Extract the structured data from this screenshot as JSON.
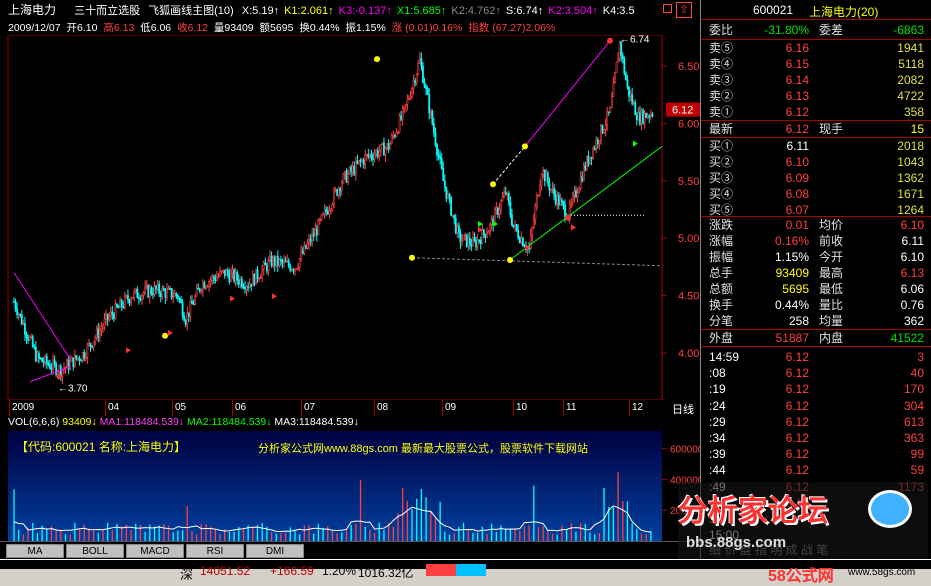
{
  "header": {
    "stock_name": "上海电力",
    "formula_name": "三十而立选股",
    "indicator_name": "飞狐画线主图",
    "indicator_param": "(10)",
    "indicators": [
      {
        "label": "X:5.19",
        "color": "#ffffff"
      },
      {
        "label": "K1:2.061",
        "color": "#ffff00"
      },
      {
        "label": "K3:-0.137",
        "color": "#ff00ff"
      },
      {
        "label": "X1:5.685",
        "color": "#00ff00"
      },
      {
        "label": "K2:4.762",
        "color": "#888888"
      },
      {
        "label": "S:6.74",
        "color": "#ffffff"
      },
      {
        "label": "K2:3.504",
        "color": "#ff00ff"
      },
      {
        "label": "K4:3.5",
        "color": "#ffffff"
      }
    ]
  },
  "infobar": {
    "date": "2009/12/07",
    "open": "开6.10",
    "high": "高6.13",
    "low": "低6.06",
    "close": "收6.12",
    "volume": "量93409",
    "amount": "额5695",
    "turnover": "换0.44%",
    "amplitude": "振1.15%",
    "change": "涨 (0.01)0.16%",
    "index": "指数 (67.27)2.06%"
  },
  "main_chart": {
    "price_axis": [
      "6.50",
      "6.00",
      "5.50",
      "5.00",
      "4.50",
      "4.00"
    ],
    "current_price_label": "6.12",
    "high_annotation": "6.74",
    "low_annotation": "3.70",
    "months": [
      "2009",
      "04",
      "05",
      "06",
      "07",
      "08",
      "09",
      "10",
      "11",
      "12"
    ],
    "period_label": "日线"
  },
  "volume": {
    "title": "VOL(6,6,6)",
    "value": "93409",
    "ma1": "MA1:118484.539",
    "ma2": "MA2:118484.539",
    "ma3": "MA3:118484.539",
    "code_label": "【代码:600021 名称:上海电力】",
    "banner": "分析家公式网www.88gs.com 最新最大股票公式，股票软件下载网站",
    "axis": [
      "600000",
      "400000",
      "200000"
    ]
  },
  "tabs": [
    "MA",
    "BOLL",
    "MACD",
    "RSI",
    "DMI"
  ],
  "right_panel": {
    "code": "600021",
    "name": "上海电力(20)",
    "weibi_label": "委比",
    "weibi_value": "-31.80%",
    "weicha_label": "委差",
    "weicha_value": "-6863",
    "sells": [
      {
        "label": "卖⑤",
        "price": "6.16",
        "vol": "1941"
      },
      {
        "label": "卖④",
        "price": "6.15",
        "vol": "5118"
      },
      {
        "label": "卖③",
        "price": "6.14",
        "vol": "2082"
      },
      {
        "label": "卖②",
        "price": "6.13",
        "vol": "4722"
      },
      {
        "label": "卖①",
        "price": "6.12",
        "vol": "358"
      }
    ],
    "latest_label": "最新",
    "latest_value": "6.12",
    "hand_label": "现手",
    "hand_value": "15",
    "buys": [
      {
        "label": "买①",
        "price": "6.11",
        "vol": "2018"
      },
      {
        "label": "买②",
        "price": "6.10",
        "vol": "1043"
      },
      {
        "label": "买③",
        "price": "6.09",
        "vol": "1362"
      },
      {
        "label": "买④",
        "price": "6.08",
        "vol": "1671"
      },
      {
        "label": "买⑤",
        "price": "6.07",
        "vol": "1264"
      }
    ],
    "stats": [
      {
        "l1": "涨跌",
        "v1": "0.01",
        "l2": "均价",
        "v2": "6.10"
      },
      {
        "l1": "涨幅",
        "v1": "0.16%",
        "l2": "前收",
        "v2": "6.11"
      },
      {
        "l1": "振幅",
        "v1": "1.15%",
        "l2": "今开",
        "v2": "6.10"
      },
      {
        "l1": "总手",
        "v1": "93409",
        "l2": "最高",
        "v2": "6.13"
      },
      {
        "l1": "总额",
        "v1": "5695",
        "l2": "最低",
        "v2": "6.06"
      },
      {
        "l1": "换手",
        "v1": "0.44%",
        "l2": "量比",
        "v2": "0.76"
      },
      {
        "l1": "分笔",
        "v1": "258",
        "l2": "均量",
        "v2": "362"
      }
    ],
    "outer_label": "外盘",
    "outer_value": "51887",
    "inner_label": "内盘",
    "inner_value": "41522",
    "ticks": [
      {
        "time": "14:59",
        "price": "6.12",
        "vol": "3"
      },
      {
        "time": ":08",
        "price": "6.12",
        "vol": "40"
      },
      {
        "time": ":19",
        "price": "6.12",
        "vol": "170"
      },
      {
        "time": ":24",
        "price": "6.12",
        "vol": "304"
      },
      {
        "time": ":29",
        "price": "6.12",
        "vol": "613"
      },
      {
        "time": ":34",
        "price": "6.12",
        "vol": "363"
      },
      {
        "time": ":39",
        "price": "6.12",
        "vol": "99"
      },
      {
        "time": ":44",
        "price": "6.12",
        "vol": "59"
      },
      {
        "time": ":49",
        "price": "6.12",
        "vol": "1173"
      },
      {
        "time": ":54",
        "price": "6.12",
        "vol": ""
      },
      {
        "time": ":56",
        "price": "",
        "vol": ""
      },
      {
        "time": "15:00",
        "price": "",
        "vol": ""
      }
    ],
    "bottom_tabs": "细 价 盘 指 明 成 战 笔"
  },
  "watermark": {
    "title": "分析家论坛",
    "url": "bbs.88gs.com",
    "site": "58公式网",
    "site_url": "www.58gs.com"
  },
  "statusbar": {
    "market": "深",
    "index": "14051.52",
    "change": "+166.59",
    "pct": "1.20%",
    "amount": "1016.32亿"
  }
}
